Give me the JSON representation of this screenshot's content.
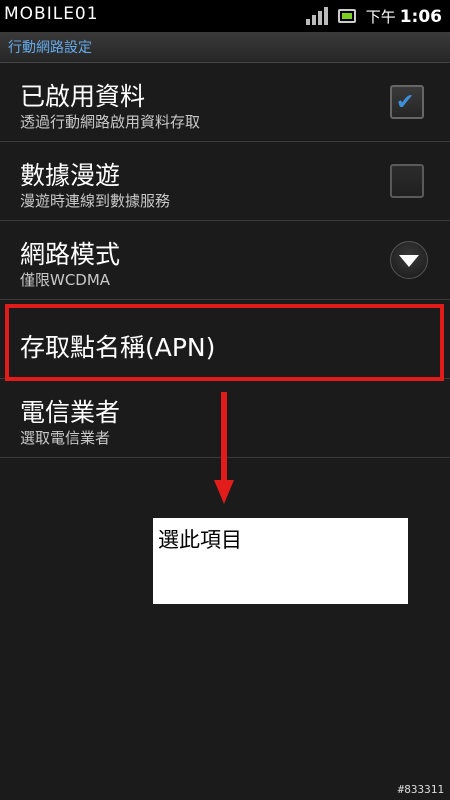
{
  "status_bar": {
    "logo": "MOBILE01",
    "ampm": "下午",
    "time": "1:06",
    "signal_icon": "signal-strength-icon",
    "battery_icon": "battery-icon"
  },
  "title_bar": {
    "title": "行動網路設定"
  },
  "settings": [
    {
      "title": "已啟用資料",
      "summary": "透過行動網路啟用資料存取",
      "control": "checkbox",
      "checked": true
    },
    {
      "title": "數據漫遊",
      "summary": "漫遊時連線到數據服務",
      "control": "checkbox",
      "checked": false
    },
    {
      "title": "網路模式",
      "summary": "僅限WCDMA",
      "control": "dropdown"
    },
    {
      "title": "存取點名稱(APN)",
      "summary": "",
      "control": "none",
      "highlighted": true
    },
    {
      "title": "電信業者",
      "summary": "選取電信業者",
      "control": "none"
    }
  ],
  "annotation": {
    "note": "選此項目",
    "color": "#e21b1b"
  },
  "watermark": "#833311",
  "colors": {
    "title_text": "#65a9e8",
    "checkmark": "#3f8fd8",
    "background": "#1b1b1b"
  }
}
